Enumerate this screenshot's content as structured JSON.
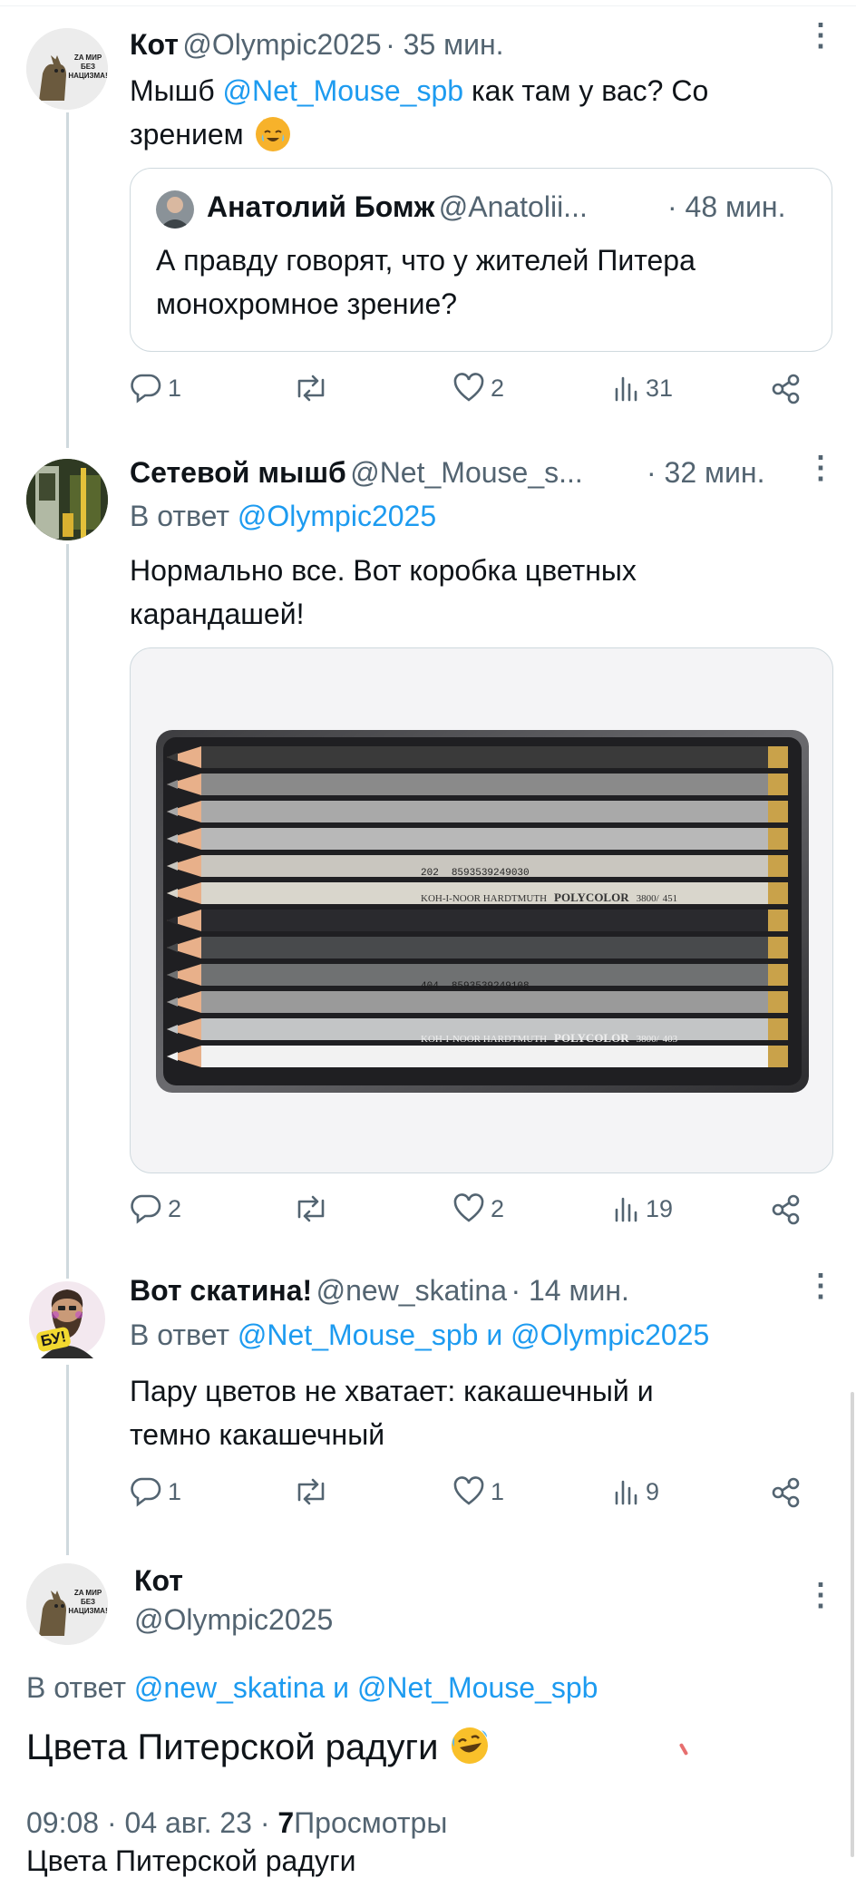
{
  "tweets": [
    {
      "name": "Кот",
      "handle": "@Olympic2025",
      "time": "· 35 мин.",
      "text_before": "Мышб ",
      "mention": "@Net_Mouse_spb",
      "text_after": " как там у вас? Со",
      "text_line2": "зрением",
      "quote": {
        "name": "Анатолий Бомж",
        "handle": "@Anatolii...",
        "time": "· 48 мин.",
        "line1": "А правду говорят, что у жителей Питера",
        "line2": "монохромное зрение?"
      },
      "stats": {
        "replies": "1",
        "reposts": "",
        "likes": "2",
        "views": "31"
      }
    },
    {
      "name": "Сетевой мышб",
      "handle": "@Net_Mouse_s...",
      "time": "· 32 мин.",
      "reply_prefix": "В ответ",
      "reply_to": "@Olympic2025",
      "line1": "Нормально все.  Вот коробка цветных",
      "line2": "карандашей!",
      "stats": {
        "replies": "2",
        "reposts": "",
        "likes": "2",
        "views": "19"
      }
    },
    {
      "name": "Вот скатина!",
      "handle": "@new_skatina",
      "time": "· 14 мин.",
      "reply_prefix": "В ответ",
      "reply_to_1": "@Net_Mouse_spb",
      "reply_join": "и",
      "reply_to_2": "@Olympic2025",
      "line1": "Пару цветов не хватает: какашечный и",
      "line2": "темно какашечный",
      "stats": {
        "replies": "1",
        "reposts": "",
        "likes": "1",
        "views": "9"
      }
    }
  ],
  "main_tweet": {
    "name": "Кот",
    "handle": "@Olympic2025",
    "reply_prefix": "В ответ",
    "reply_to_1": "@new_skatina",
    "reply_join": "и",
    "reply_to_2": "@Net_Mouse_spb",
    "text": "Цвета Питерской радуги",
    "timestamp": "09:08 · 04 авг. 23 ·",
    "views_count": "7",
    "views_label": "Просмотры",
    "cut_line": "Цвета Питерской радуги"
  },
  "avatar_text": {
    "line1": "ZA МИР",
    "line2": "БЕЗ НАЦИЗМА!"
  },
  "badge_text": "БУ!",
  "pencil_labels": {
    "code1": "202",
    "barcode1": "8593539249030",
    "brand": "KOH-I-NOOR HARDTMUTH",
    "series": "POLYCOLOR",
    "item1": "3800/",
    "num1": "451",
    "code2": "404",
    "barcode2": "8593539249108",
    "num2": "403"
  },
  "icons": [
    "reply-icon",
    "repost-icon",
    "like-icon",
    "views-icon",
    "share-icon",
    "more-icon"
  ],
  "colors": {
    "link": "#1d9bf0",
    "secondary": "#536471",
    "divider": "#cfd9de"
  }
}
